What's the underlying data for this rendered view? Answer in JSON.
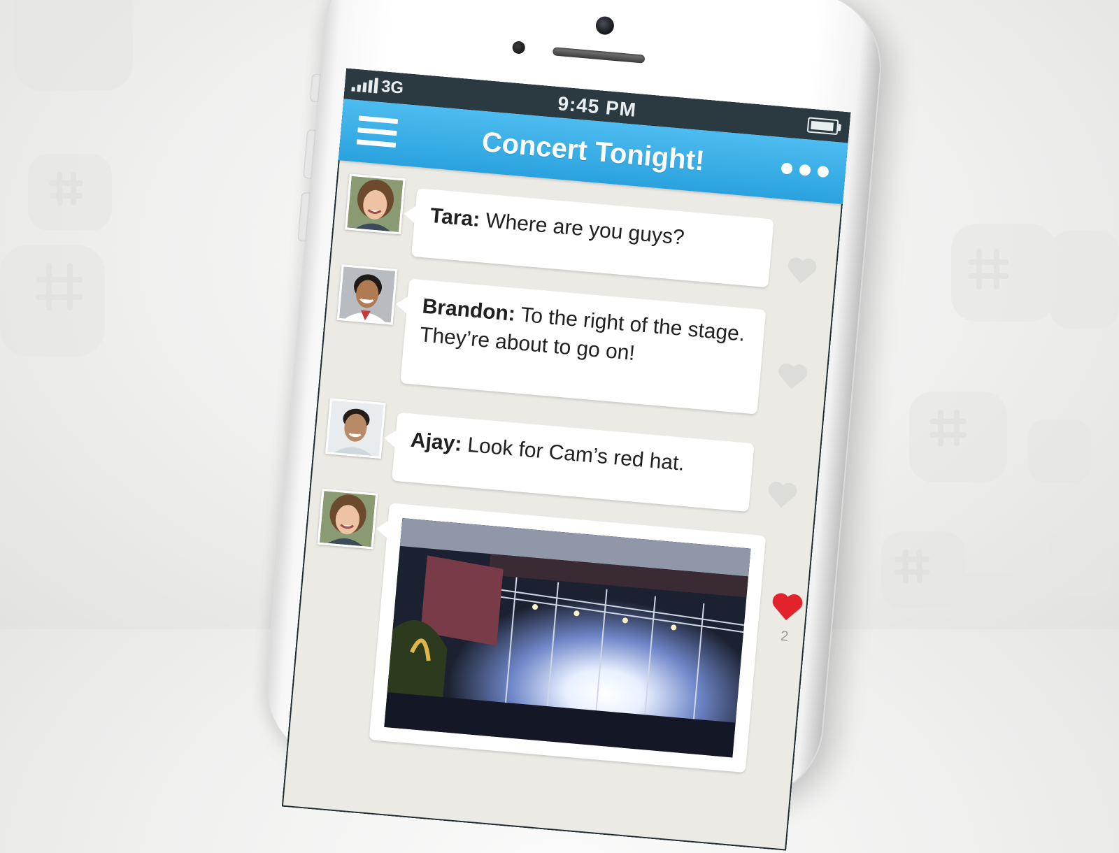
{
  "status_bar": {
    "network": "3G",
    "time": "9:45 PM"
  },
  "nav": {
    "title": "Concert Tonight!"
  },
  "messages": [
    {
      "author": "Tara:",
      "text": "Where are you guys?"
    },
    {
      "author": "Brandon:",
      "text": "To the right of the stage. They’re about to go on!"
    },
    {
      "author": "Ajay:",
      "text": "Look for Cam’s red hat."
    },
    {
      "author": "",
      "text": "",
      "likes": "2"
    }
  ],
  "colors": {
    "nav_blue": "#2aa2de",
    "status_dark": "#2b3a41",
    "like_red": "#e3232b",
    "like_grey": "#dcdcd8"
  }
}
